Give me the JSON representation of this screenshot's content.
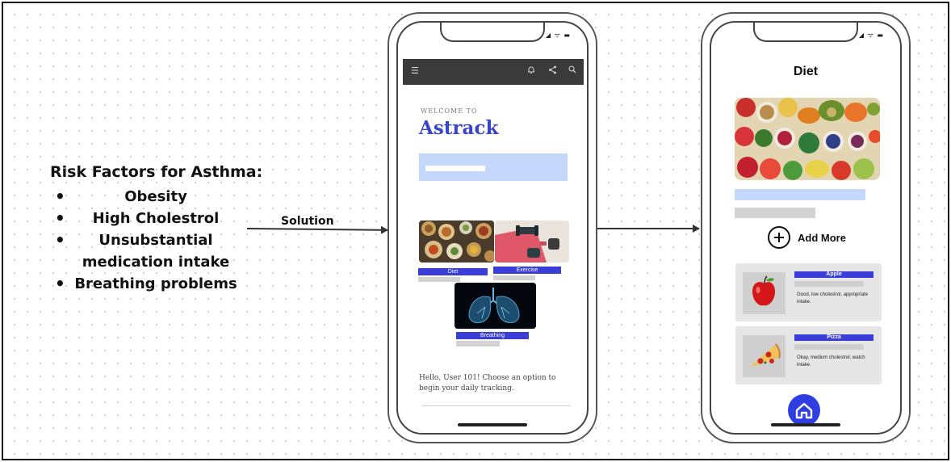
{
  "risk": {
    "title": "Risk Factors for Asthma:",
    "items": [
      "Obesity",
      "High Cholestrol",
      "Unsubstantial",
      "medication intake",
      "Breathing problems"
    ]
  },
  "arrow_label": "Solution",
  "phone1": {
    "welcome": "WELCOME TO",
    "brand": "Astrack",
    "tiles": [
      "Diet",
      "Exercise",
      "Breathing"
    ],
    "hello": "Hello, User 101! Choose an option to begin your daily tracking."
  },
  "phone2": {
    "title": "Diet",
    "add_more": "Add More",
    "cards": [
      {
        "name": "Apple",
        "desc": "Good, low cholestrol, appropriate intake."
      },
      {
        "name": "Pizza",
        "desc": "Okay, medium cholestrol, watch intake."
      }
    ]
  },
  "colors": {
    "accent_blue": "#3b3dd8",
    "brand_blue": "#3a46c9",
    "light_blue": "#c5d8fb",
    "home_button": "#2f3ee0"
  }
}
